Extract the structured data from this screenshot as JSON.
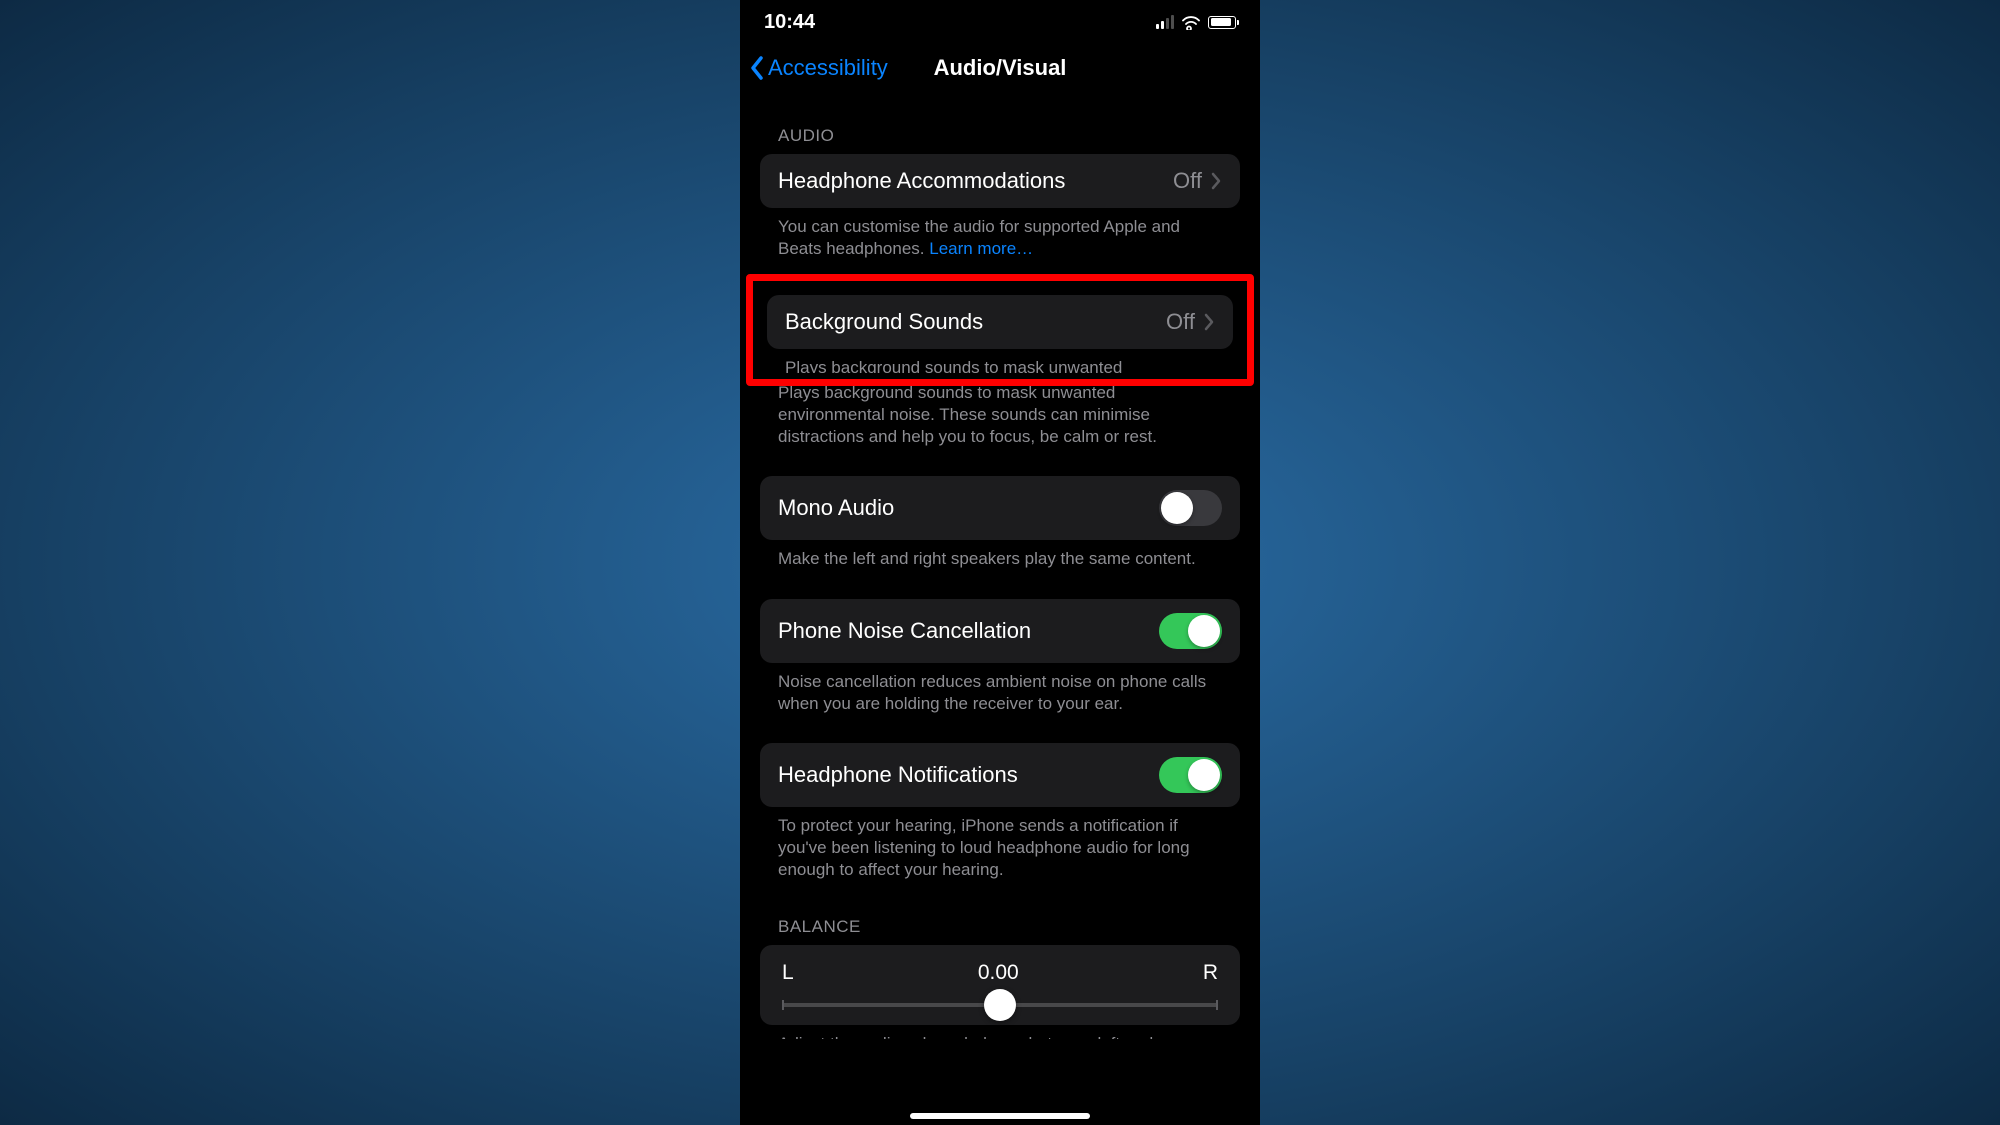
{
  "status": {
    "time": "10:44"
  },
  "nav": {
    "back": "Accessibility",
    "title": "Audio/Visual"
  },
  "sections": {
    "audio": {
      "header": "AUDIO"
    },
    "balance": {
      "header": "BALANCE"
    }
  },
  "rows": {
    "headphone_accommodations": {
      "label": "Headphone Accommodations",
      "value": "Off",
      "footer_text": "You can customise the audio for supported Apple and Beats headphones. ",
      "footer_link": "Learn more…"
    },
    "background_sounds": {
      "label": "Background Sounds",
      "value": "Off",
      "footer": "Plays background sounds to mask unwanted environmental noise. These sounds can minimise distractions and help you to focus, be calm or rest."
    },
    "mono_audio": {
      "label": "Mono Audio",
      "on": false,
      "footer": "Make the left and right speakers play the same content."
    },
    "phone_noise": {
      "label": "Phone Noise Cancellation",
      "on": true,
      "footer": "Noise cancellation reduces ambient noise on phone calls when you are holding the receiver to your ear."
    },
    "headphone_notifications": {
      "label": "Headphone Notifications",
      "on": true,
      "footer": "To protect your hearing, iPhone sends a notification if you've been listening to loud headphone audio for long enough to affect your hearing."
    },
    "balance": {
      "left": "L",
      "value": "0.00",
      "right": "R",
      "footer": "Adjust the audio volume balance between left and"
    }
  }
}
